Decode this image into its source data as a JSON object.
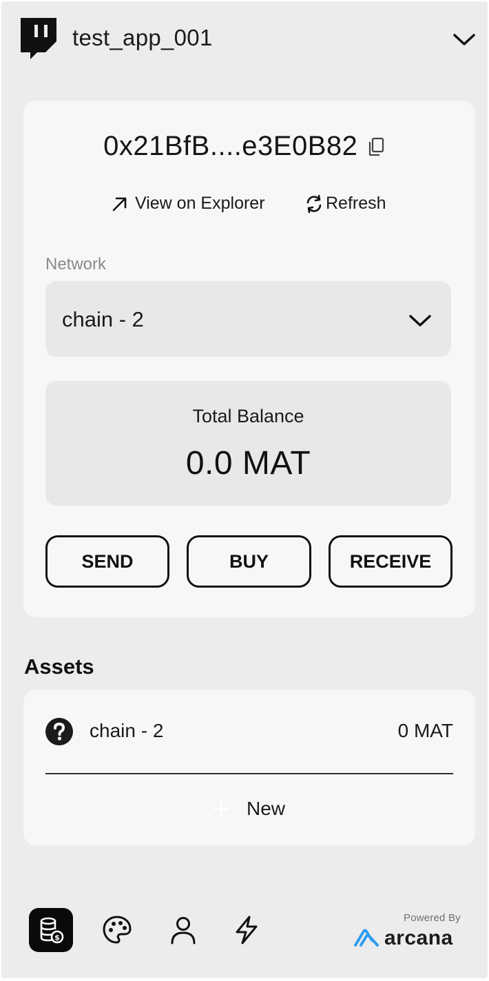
{
  "header": {
    "app_name": "test_app_001",
    "logo_icon": "twitch-logo-icon",
    "menu_icon": "chevron-down-icon"
  },
  "wallet": {
    "address": "0x21BfB....e3E0B82",
    "copy_icon": "copy-icon",
    "explorer_label": "View on Explorer",
    "refresh_label": "Refresh"
  },
  "network": {
    "label": "Network",
    "selected": "chain - 2"
  },
  "balance": {
    "label": "Total Balance",
    "value": "0.0 MAT"
  },
  "actions": {
    "send": "SEND",
    "buy": "BUY",
    "receive": "RECEIVE"
  },
  "assets": {
    "title": "Assets",
    "items": [
      {
        "name": "chain - 2",
        "amount": "0 MAT",
        "icon": "unknown-token-icon"
      }
    ],
    "new_label": "New"
  },
  "bottom_nav": {
    "items": [
      "wallet-icon",
      "palette-icon",
      "profile-icon",
      "activity-icon"
    ],
    "active": "wallet-icon"
  },
  "footer": {
    "powered_by": "Powered By",
    "brand": "arcana"
  },
  "colors": {
    "background": "#ececec",
    "card": "#f7f7f7",
    "field": "#e8e8e8",
    "text": "#111111",
    "brand_blue": "#2d9cf0"
  }
}
